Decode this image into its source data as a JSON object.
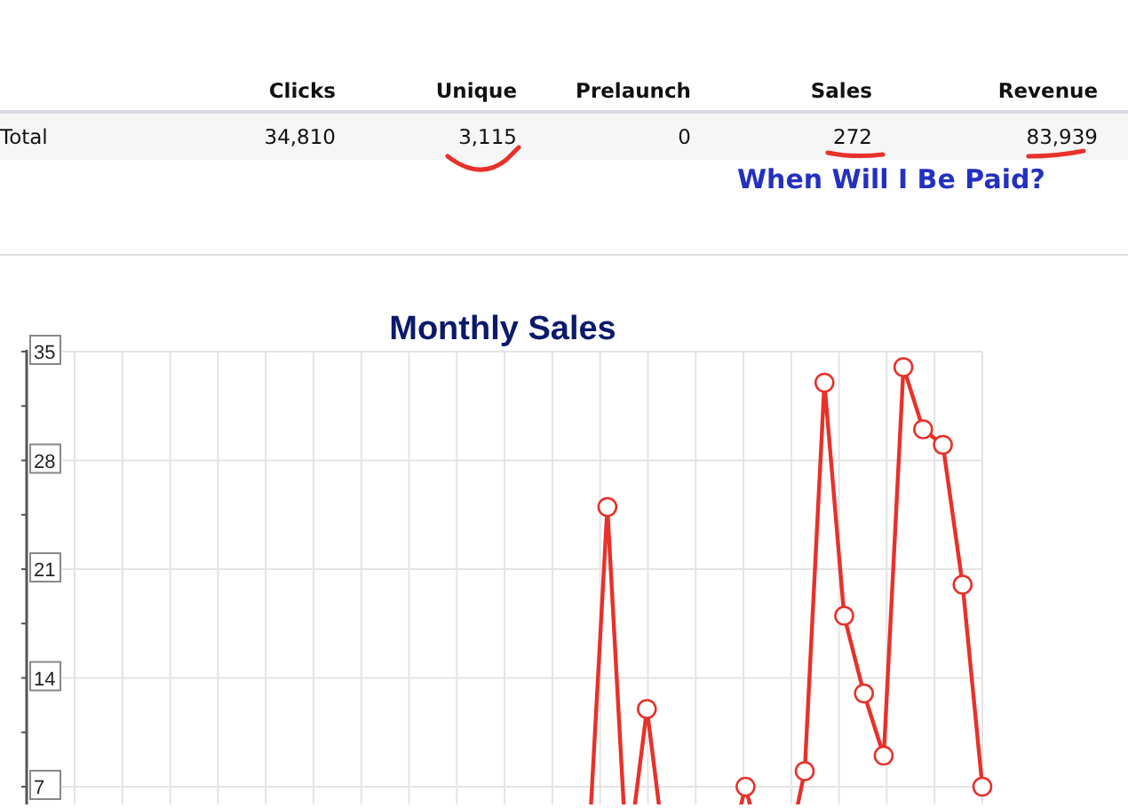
{
  "table": {
    "columns": [
      "",
      "Clicks",
      "Unique",
      "Prelaunch",
      "Sales",
      "Revenue"
    ],
    "rows": [
      {
        "cells": [
          "Total",
          "34,810",
          "3,115",
          "0",
          "272",
          "83,939"
        ]
      }
    ]
  },
  "note": "When Will I Be Paid?",
  "chart": {
    "title": "Monthly Sales",
    "y_tick_labels": [
      "35",
      "28",
      "21",
      "14",
      "7"
    ]
  }
}
